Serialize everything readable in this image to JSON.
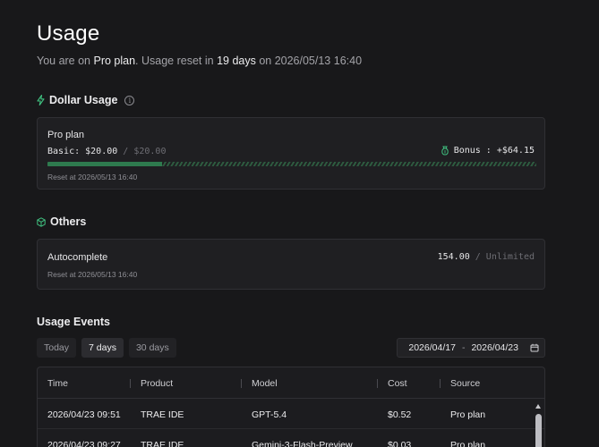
{
  "header": {
    "title": "Usage",
    "subtitle_prefix": "You are on ",
    "plan": "Pro plan",
    "subtitle_mid": ". Usage reset in ",
    "days": "19 days",
    "subtitle_on": " on ",
    "reset_datetime": "2026/05/13 16:40"
  },
  "dollar_usage": {
    "title": "Dollar Usage",
    "info_icon": "i",
    "icon": "lightning-icon",
    "card": {
      "plan_name": "Pro plan",
      "basic_label": "Basic: $20.00",
      "basic_limit": " / $20.00",
      "bonus_icon": "money-bag-icon",
      "bonus_text": "Bonus : +$64.15",
      "progress_fraction": 0.235,
      "reset_text": "Reset at 2026/05/13 16:40"
    }
  },
  "others": {
    "title": "Others",
    "icon": "cube-icon",
    "card": {
      "name": "Autocomplete",
      "value": "154.00",
      "limit": " / Unlimited",
      "reset_text": "Reset at 2026/05/13 16:40"
    }
  },
  "events": {
    "title": "Usage Events",
    "tabs": [
      {
        "label": "Today",
        "active": false
      },
      {
        "label": "7 days",
        "active": true
      },
      {
        "label": "30 days",
        "active": false
      }
    ],
    "date_from": "2026/04/17",
    "date_sep": "-",
    "date_to": "2026/04/23",
    "columns": [
      "Time",
      "Product",
      "Model",
      "Cost",
      "Source"
    ],
    "rows": [
      {
        "time": "2026/04/23 09:51",
        "product": "TRAE IDE",
        "model": "GPT-5.4",
        "cost": "$0.52",
        "source": "Pro plan"
      },
      {
        "time": "2026/04/23 09:27",
        "product": "TRAE IDE",
        "model": "Gemini-3-Flash-Preview",
        "cost": "$0.03",
        "source": "Pro plan"
      }
    ]
  },
  "colors": {
    "accent_green": "#3fbf7f",
    "progress_fill": "#2e7a4e",
    "background": "#18181a"
  }
}
